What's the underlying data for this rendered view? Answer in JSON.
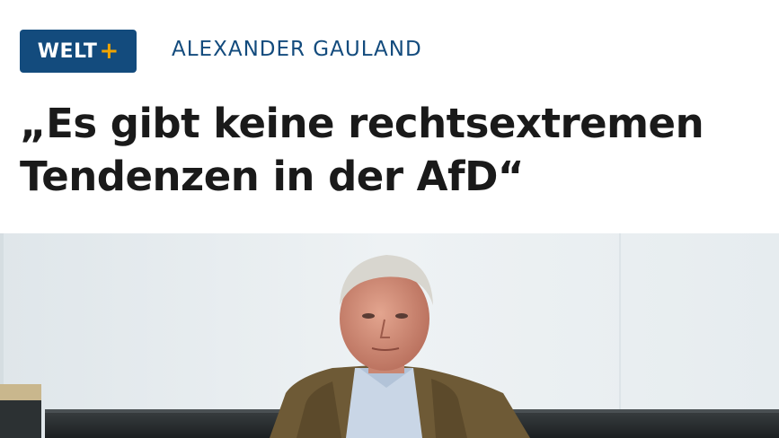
{
  "brand": {
    "name": "WELT",
    "plus": "+"
  },
  "article": {
    "kicker": "ALEXANDER GAULAND",
    "headline_lines": [
      "„Es gibt keine rechtsextremen",
      "Tendenzen in der AfD“"
    ]
  },
  "colors": {
    "brand_blue": "#134b7d",
    "brand_accent": "#f0a400",
    "headline": "#1a1a1a"
  }
}
